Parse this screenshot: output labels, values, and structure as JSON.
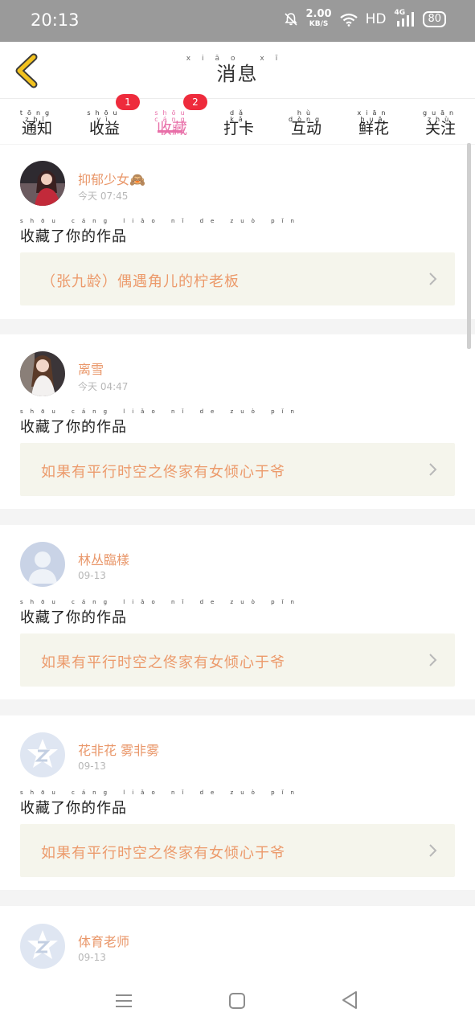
{
  "status": {
    "time": "20:13",
    "speed_value": "2.00",
    "speed_unit": "KB/S",
    "hd": "HD",
    "net": "4G",
    "battery": "80"
  },
  "header": {
    "title": "消息",
    "title_pinyin": "xiāo xī"
  },
  "tabs": [
    {
      "label": "通知",
      "pinyin": "tōng zhī"
    },
    {
      "label": "收益",
      "pinyin": "shōu yì",
      "badge": "1"
    },
    {
      "label": "收藏",
      "pinyin": "shōu cáng",
      "badge": "2",
      "active": true
    },
    {
      "label": "打卡",
      "pinyin": "dǎ kǎ"
    },
    {
      "label": "互动",
      "pinyin": "hù dòng"
    },
    {
      "label": "鲜花",
      "pinyin": "xiān huā"
    },
    {
      "label": "关注",
      "pinyin": "guān zhù"
    }
  ],
  "messages": [
    {
      "user": "抑郁少女🙈",
      "time": "今天 07:45",
      "action": "收藏了你的作品",
      "action_pinyin": "shōu cáng liǎo nǐ de zuò pǐn",
      "work": "（张九龄）偶遇角儿的柠老板"
    },
    {
      "user": "离雪",
      "time": "今天 04:47",
      "action": "收藏了你的作品",
      "action_pinyin": "shōu cáng liǎo nǐ de zuò pǐn",
      "work": "如果有平行时空之佟家有女倾心于爷"
    },
    {
      "user": "林丛臨樣",
      "time": "09-13",
      "action": "收藏了你的作品",
      "action_pinyin": "shōu cáng liǎo nǐ de zuò pǐn",
      "work": "如果有平行时空之佟家有女倾心于爷"
    },
    {
      "user": "花非花 雾非雾",
      "time": "09-13",
      "action": "收藏了你的作品",
      "action_pinyin": "shōu cáng liǎo nǐ de zuò pǐn",
      "work": "如果有平行时空之佟家有女倾心于爷"
    },
    {
      "user": "体育老师",
      "time": "09-13"
    }
  ],
  "icons": {
    "back": "chevron-left-icon",
    "mute": "bell-off-icon",
    "wifi": "wifi-icon",
    "signal": "signal-icon",
    "chevron": "chevron-right-icon"
  },
  "colors": {
    "accent": "#e86fa8",
    "username": "#e9976a",
    "badge": "#ee2b3c",
    "work_bg": "#f5f5ec"
  }
}
